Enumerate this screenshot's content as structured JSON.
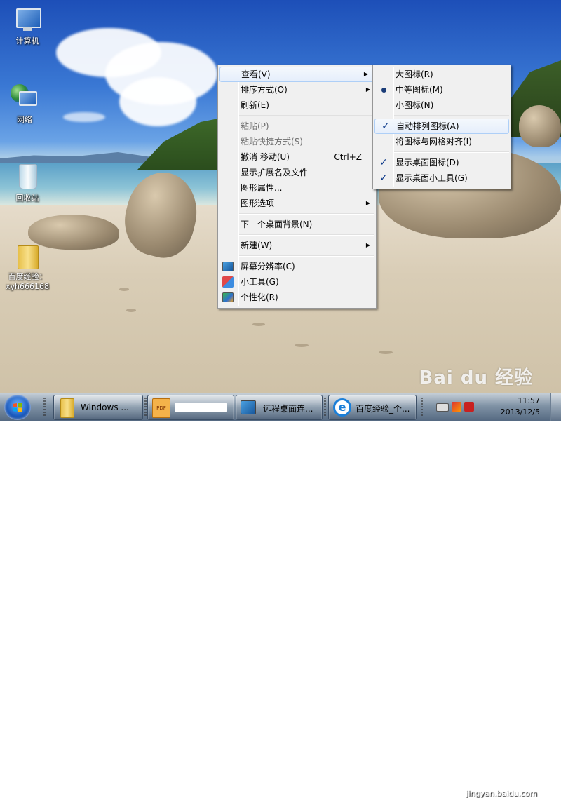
{
  "desktop": {
    "icons": [
      {
        "label": "计算机",
        "icon": "computer-icon"
      },
      {
        "label": "网络",
        "icon": "network-icon"
      },
      {
        "label": "回收站",
        "icon": "recycle-bin-icon"
      },
      {
        "label_line1": "百度经验：",
        "label_line2": "xyh666168",
        "icon": "folder-icon"
      }
    ]
  },
  "context_menu": {
    "items": [
      {
        "label": "查看(V)",
        "submenu": true,
        "highlighted": true
      },
      {
        "label": "排序方式(O)",
        "submenu": true
      },
      {
        "label": "刷新(E)"
      },
      {
        "label": "粘贴(P)",
        "disabled": true
      },
      {
        "label": "粘贴快捷方式(S)",
        "disabled": true
      },
      {
        "label": "撤消 移动(U)",
        "shortcut": "Ctrl+Z"
      },
      {
        "label": "显示扩展名及文件"
      },
      {
        "label": "图形属性..."
      },
      {
        "label": "图形选项",
        "submenu": true
      },
      {
        "label": "下一个桌面背景(N)"
      },
      {
        "label": "新建(W)",
        "submenu": true
      },
      {
        "label": "屏幕分辨率(C)",
        "icon": "display-icon"
      },
      {
        "label": "小工具(G)",
        "icon": "gadgets-icon"
      },
      {
        "label": "个性化(R)",
        "icon": "personalize-icon"
      }
    ]
  },
  "view_submenu": {
    "items": [
      {
        "label": "大图标(R)"
      },
      {
        "label": "中等图标(M)",
        "mark": "radio"
      },
      {
        "label": "小图标(N)"
      },
      {
        "label": "自动排列图标(A)",
        "mark": "check",
        "highlighted": true
      },
      {
        "label": "将图标与网格对齐(I)"
      },
      {
        "label": "显示桌面图标(D)",
        "mark": "check"
      },
      {
        "label": "显示桌面小工具(G)",
        "mark": "check"
      }
    ],
    "check_glyph": "✓"
  },
  "taskbar": {
    "buttons": [
      {
        "label": "Windows ...",
        "icon": "folder-icon"
      },
      {
        "label": "",
        "icon": "pdf-icon",
        "redacted": true
      },
      {
        "label": "远程桌面连...",
        "icon": "remote-desktop-icon"
      },
      {
        "label": "百度经验_个...",
        "icon": "ie-icon"
      }
    ],
    "clock_time": "11:57",
    "clock_date": "2013/12/5"
  },
  "watermark": {
    "brand": "Bai du 经验",
    "url": "jingyan.baidu.com"
  },
  "colors": {
    "menu_bg": "#f0f0f0",
    "highlight_border": "#aecff7",
    "check": "#0d3a8a"
  }
}
